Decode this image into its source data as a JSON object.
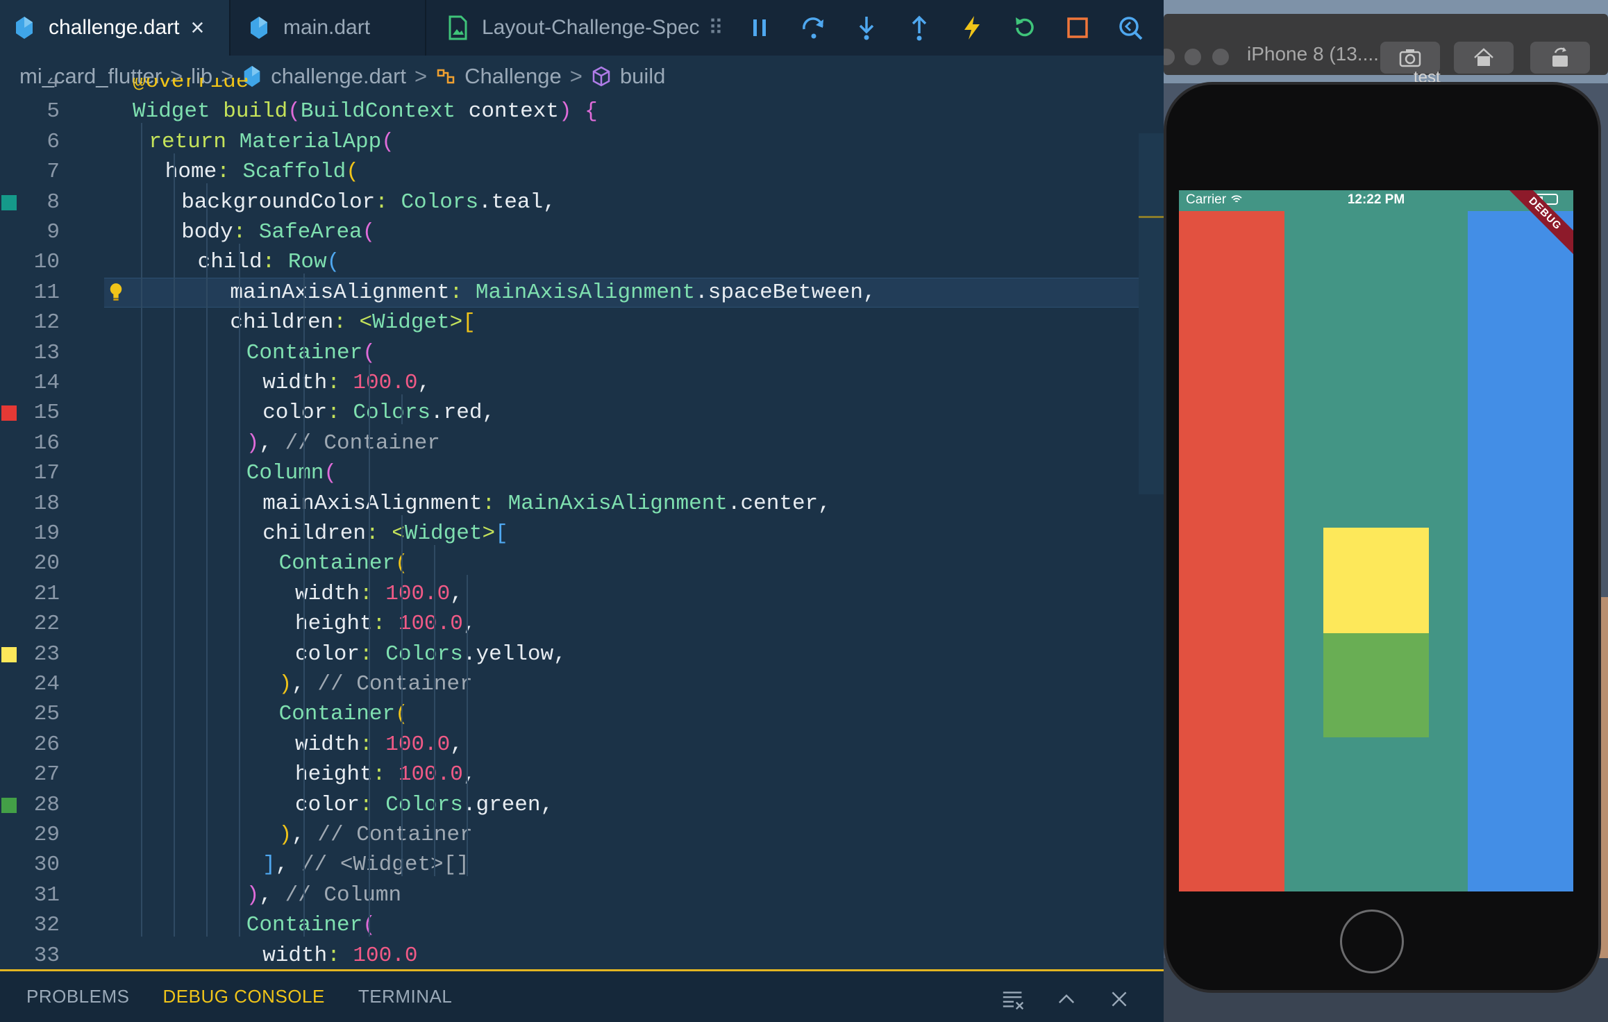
{
  "tabs": [
    {
      "label": "challenge.dart",
      "active": true,
      "icon": "dart-icon",
      "close": "×"
    },
    {
      "label": "main.dart",
      "active": false,
      "icon": "dart-icon"
    },
    {
      "label": "Layout-Challenge-Spec",
      "active": false,
      "icon": "image-file-icon"
    }
  ],
  "debug_toolbar": {
    "icons": [
      "drag-grip-icon",
      "pause-icon",
      "step-over-icon",
      "step-into-icon",
      "step-out-icon",
      "hot-reload-icon",
      "restart-icon",
      "stop-icon",
      "devtools-icon"
    ],
    "colors": {
      "pause": "#4fa8f0",
      "step": "#4fa8f0",
      "hot_reload": "#f0c419",
      "restart": "#3fc47a",
      "stop": "#f0763a",
      "devtools": "#4fa8f0"
    }
  },
  "breadcrumb": {
    "items": [
      "mi_card_flutter",
      "lib",
      "challenge.dart",
      "Challenge",
      "build"
    ],
    "sep": ">"
  },
  "code": {
    "lines": [
      {
        "n": "4",
        "indent": 5,
        "tokens": [
          [
            "ann",
            "@override"
          ]
        ]
      },
      {
        "n": "5",
        "indent": 5,
        "tokens": [
          [
            "cls",
            "Widget"
          ],
          [
            "pnc",
            " "
          ],
          [
            "kw",
            "build"
          ],
          [
            "bk1",
            "("
          ],
          [
            "cls",
            "BuildContext"
          ],
          [
            "pnc",
            " context"
          ],
          [
            "bk1",
            ")"
          ],
          [
            "pnc",
            " "
          ],
          [
            "bk1",
            "{"
          ]
        ]
      },
      {
        "n": "6",
        "indent": 6,
        "tokens": [
          [
            "kw",
            "return"
          ],
          [
            "pnc",
            " "
          ],
          [
            "cls",
            "MaterialApp"
          ],
          [
            "bk1",
            "("
          ]
        ]
      },
      {
        "n": "7",
        "indent": 7,
        "tokens": [
          [
            "key",
            "home"
          ],
          [
            "col",
            ":"
          ],
          [
            "pnc",
            " "
          ],
          [
            "cls",
            "Scaffold"
          ],
          [
            "bk2",
            "("
          ]
        ]
      },
      {
        "n": "8",
        "indent": 8,
        "tokens": [
          [
            "key",
            "backgroundColor"
          ],
          [
            "col",
            ":"
          ],
          [
            "pnc",
            " "
          ],
          [
            "cls",
            "Colors"
          ],
          [
            "pnc",
            ".teal,"
          ]
        ],
        "marker": "#159a8a"
      },
      {
        "n": "9",
        "indent": 8,
        "tokens": [
          [
            "key",
            "body"
          ],
          [
            "col",
            ":"
          ],
          [
            "pnc",
            " "
          ],
          [
            "cls",
            "SafeArea"
          ],
          [
            "bk1",
            "("
          ]
        ]
      },
      {
        "n": "10",
        "indent": 9,
        "tokens": [
          [
            "key",
            "child"
          ],
          [
            "col",
            ":"
          ],
          [
            "pnc",
            " "
          ],
          [
            "cls",
            "Row"
          ],
          [
            "bk3",
            "("
          ]
        ]
      },
      {
        "n": "11",
        "indent": 11,
        "tokens": [
          [
            "key",
            "mainAxisAlignment"
          ],
          [
            "col",
            ":"
          ],
          [
            "pnc",
            " "
          ],
          [
            "cls",
            "MainAxisAlignment"
          ],
          [
            "pnc",
            ".spaceBetween,"
          ]
        ],
        "current": true,
        "bulb": true
      },
      {
        "n": "12",
        "indent": 11,
        "tokens": [
          [
            "key",
            "children"
          ],
          [
            "col",
            ":"
          ],
          [
            "pnc",
            " "
          ],
          [
            "kw",
            "<"
          ],
          [
            "cls",
            "Widget"
          ],
          [
            "kw",
            ">"
          ],
          [
            "bk2",
            "["
          ]
        ]
      },
      {
        "n": "13",
        "indent": 12,
        "tokens": [
          [
            "cls",
            "Container"
          ],
          [
            "bk1",
            "("
          ]
        ]
      },
      {
        "n": "14",
        "indent": 13,
        "tokens": [
          [
            "key",
            "width"
          ],
          [
            "col",
            ":"
          ],
          [
            "pnc",
            " "
          ],
          [
            "num",
            "100.0"
          ],
          [
            "pnc",
            ","
          ]
        ]
      },
      {
        "n": "15",
        "indent": 13,
        "tokens": [
          [
            "key",
            "color"
          ],
          [
            "col",
            ":"
          ],
          [
            "pnc",
            " "
          ],
          [
            "cls",
            "Colors"
          ],
          [
            "pnc",
            ".red,"
          ]
        ],
        "marker": "#e53935"
      },
      {
        "n": "16",
        "indent": 12,
        "tokens": [
          [
            "bk1",
            ")"
          ],
          [
            "pnc",
            ", "
          ],
          [
            "cm",
            "// Container"
          ]
        ]
      },
      {
        "n": "17",
        "indent": 12,
        "tokens": [
          [
            "cls",
            "Column"
          ],
          [
            "bk1",
            "("
          ]
        ]
      },
      {
        "n": "18",
        "indent": 13,
        "tokens": [
          [
            "key",
            "mainAxisAlignment"
          ],
          [
            "col",
            ":"
          ],
          [
            "pnc",
            " "
          ],
          [
            "cls",
            "MainAxisAlignment"
          ],
          [
            "pnc",
            ".center,"
          ]
        ]
      },
      {
        "n": "19",
        "indent": 13,
        "tokens": [
          [
            "key",
            "children"
          ],
          [
            "col",
            ":"
          ],
          [
            "pnc",
            " "
          ],
          [
            "kw",
            "<"
          ],
          [
            "cls",
            "Widget"
          ],
          [
            "kw",
            ">"
          ],
          [
            "bk3",
            "["
          ]
        ]
      },
      {
        "n": "20",
        "indent": 14,
        "tokens": [
          [
            "cls",
            "Container"
          ],
          [
            "bk2",
            "("
          ]
        ]
      },
      {
        "n": "21",
        "indent": 15,
        "tokens": [
          [
            "key",
            "width"
          ],
          [
            "col",
            ":"
          ],
          [
            "pnc",
            " "
          ],
          [
            "num",
            "100.0"
          ],
          [
            "pnc",
            ","
          ]
        ]
      },
      {
        "n": "22",
        "indent": 15,
        "tokens": [
          [
            "key",
            "height"
          ],
          [
            "col",
            ":"
          ],
          [
            "pnc",
            " "
          ],
          [
            "num",
            "100.0"
          ],
          [
            "pnc",
            ","
          ]
        ]
      },
      {
        "n": "23",
        "indent": 15,
        "tokens": [
          [
            "key",
            "color"
          ],
          [
            "col",
            ":"
          ],
          [
            "pnc",
            " "
          ],
          [
            "cls",
            "Colors"
          ],
          [
            "pnc",
            ".yellow,"
          ]
        ],
        "marker": "#fde85a"
      },
      {
        "n": "24",
        "indent": 14,
        "tokens": [
          [
            "bk2",
            ")"
          ],
          [
            "pnc",
            ", "
          ],
          [
            "cm",
            "// Container"
          ]
        ]
      },
      {
        "n": "25",
        "indent": 14,
        "tokens": [
          [
            "cls",
            "Container"
          ],
          [
            "bk2",
            "("
          ]
        ]
      },
      {
        "n": "26",
        "indent": 15,
        "tokens": [
          [
            "key",
            "width"
          ],
          [
            "col",
            ":"
          ],
          [
            "pnc",
            " "
          ],
          [
            "num",
            "100.0"
          ],
          [
            "pnc",
            ","
          ]
        ]
      },
      {
        "n": "27",
        "indent": 15,
        "tokens": [
          [
            "key",
            "height"
          ],
          [
            "col",
            ":"
          ],
          [
            "pnc",
            " "
          ],
          [
            "num",
            "100.0"
          ],
          [
            "pnc",
            ","
          ]
        ]
      },
      {
        "n": "28",
        "indent": 15,
        "tokens": [
          [
            "key",
            "color"
          ],
          [
            "col",
            ":"
          ],
          [
            "pnc",
            " "
          ],
          [
            "cls",
            "Colors"
          ],
          [
            "pnc",
            ".green,"
          ]
        ],
        "marker": "#43a047"
      },
      {
        "n": "29",
        "indent": 14,
        "tokens": [
          [
            "bk2",
            ")"
          ],
          [
            "pnc",
            ", "
          ],
          [
            "cm",
            "// Container"
          ]
        ]
      },
      {
        "n": "30",
        "indent": 13,
        "tokens": [
          [
            "bk3",
            "]"
          ],
          [
            "pnc",
            ", "
          ],
          [
            "cm",
            "// <Widget>[]"
          ]
        ]
      },
      {
        "n": "31",
        "indent": 12,
        "tokens": [
          [
            "bk1",
            ")"
          ],
          [
            "pnc",
            ", "
          ],
          [
            "cm",
            "// Column"
          ]
        ]
      },
      {
        "n": "32",
        "indent": 12,
        "tokens": [
          [
            "cls",
            "Container"
          ],
          [
            "bk1",
            "("
          ]
        ]
      },
      {
        "n": "33",
        "indent": 13,
        "tokens": [
          [
            "key",
            "width"
          ],
          [
            "col",
            ":"
          ],
          [
            "pnc",
            " "
          ],
          [
            "num",
            "100.0"
          ]
        ]
      }
    ]
  },
  "panel": {
    "tabs": [
      {
        "label": "PROBLEMS",
        "active": false
      },
      {
        "label": "DEBUG CONSOLE",
        "active": true
      },
      {
        "label": "TERMINAL",
        "active": false
      }
    ],
    "controls": [
      "clear-console-icon",
      "chevron-up-icon",
      "close-icon"
    ]
  },
  "simulator": {
    "title": "iPhone 8 (13....",
    "buttons": [
      "screenshot-icon",
      "home-icon",
      "rotate-icon"
    ],
    "label": "test",
    "status": {
      "carrier": "Carrier",
      "time": "12:22 PM"
    },
    "debug_banner": "DEBUG",
    "colors": {
      "background": "#439585",
      "red": "#e25140",
      "yellow": "#fde85a",
      "green": "#69ae54",
      "blue": "#438ee6"
    }
  }
}
